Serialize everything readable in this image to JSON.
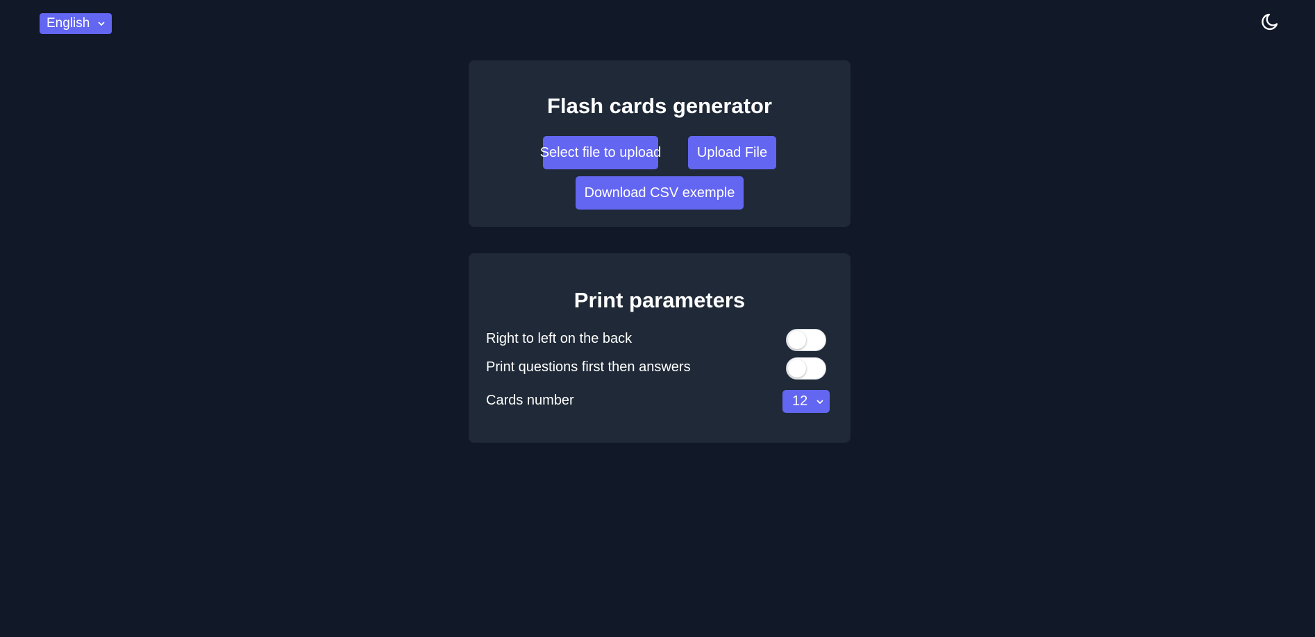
{
  "header": {
    "language": {
      "selected": "English",
      "icon": "chevron-down-icon"
    },
    "theme_toggle": {
      "icon": "moon-icon"
    }
  },
  "generator": {
    "title": "Flash cards generator",
    "select_file_label": "Select file to upload",
    "upload_label": "Upload File",
    "download_csv_label": "Download CSV exemple"
  },
  "print": {
    "title": "Print parameters",
    "rtl_label": "Right to left on the back",
    "rtl_enabled": false,
    "questions_first_label": "Print questions first then answers",
    "questions_first_enabled": false,
    "cards_number_label": "Cards number",
    "cards_number_value": "12"
  },
  "colors": {
    "background": "#111827",
    "card": "#1f2937",
    "accent": "#6366f1"
  }
}
